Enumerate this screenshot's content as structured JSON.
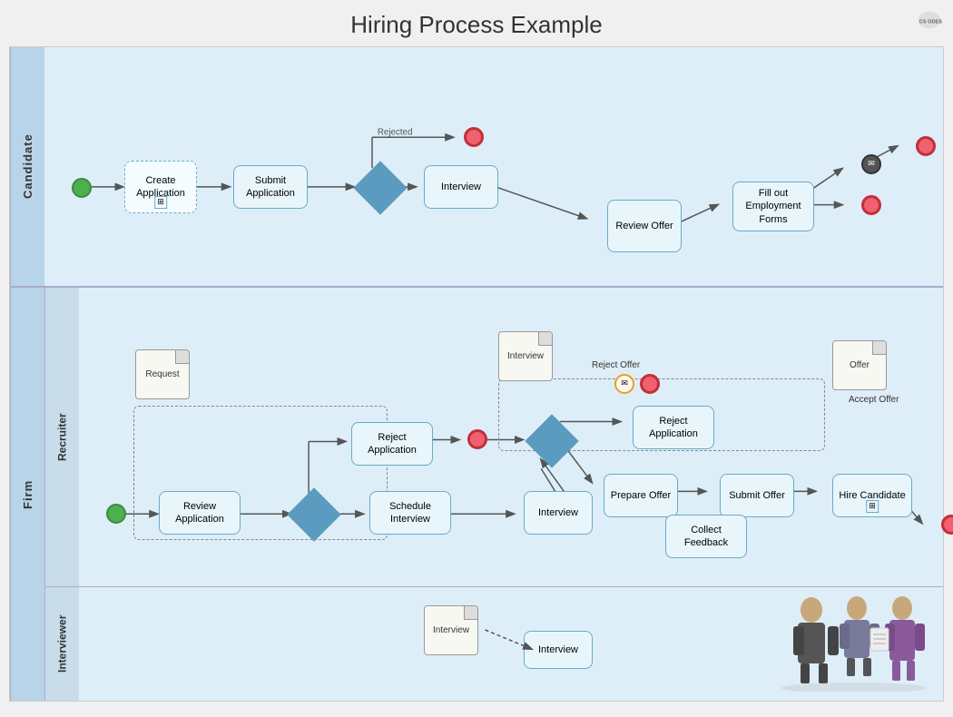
{
  "title": "Hiring Process Example",
  "logo": "CS ODESSA",
  "candidate_lane": "Candidate",
  "firm_lane": "Firm",
  "recruiter_sublane": "Recruiter",
  "interviewer_sublane": "Interviewer",
  "nodes": {
    "create_application": "Create Application",
    "submit_application": "Submit Application",
    "interview_candidate": "Interview",
    "review_offer": "Review Offer",
    "fill_employment": "Fill out Employment Forms",
    "rejected_label": "Rejected",
    "review_application": "Review Application",
    "reject_application_1": "Reject Application",
    "schedule_interview": "Schedule Interview",
    "interview_firm": "Interview",
    "collect_feedback": "Collect Feedback",
    "prepare_offer": "Prepare Offer",
    "submit_offer": "Submit Offer",
    "hire_candidate": "Hire Candidate",
    "reject_application_2": "Reject Application",
    "reject_offer": "Reject Offer",
    "interview_interviewer": "Interview",
    "interview_doc": "Interview",
    "request_doc": "Request",
    "offer_doc": "Offer",
    "accept_offer_label": "Accept Offer"
  }
}
